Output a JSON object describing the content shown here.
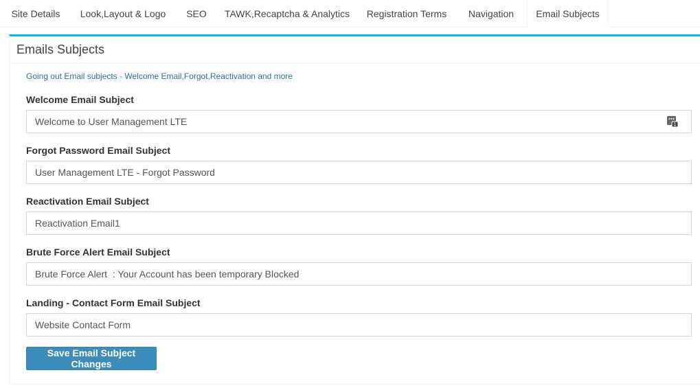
{
  "tabs": [
    {
      "label": "Site Details"
    },
    {
      "label": "Look,Layout & Logo"
    },
    {
      "label": "SEO"
    },
    {
      "label": "TAWK,Recaptcha & Analytics"
    },
    {
      "label": "Registration Terms"
    },
    {
      "label": "Navigation"
    },
    {
      "label": "Email Subjects",
      "active": true
    }
  ],
  "panel": {
    "title": "Emails Subjects",
    "description": "Going out Email subjects - Welcome Email,Forgot,Reactivation and more"
  },
  "fields": [
    {
      "label": "Welcome Email Subject",
      "value": "Welcome to User Management LTE"
    },
    {
      "label": "Forgot Password Email Subject",
      "value": "User Management LTE - Forgot Password"
    },
    {
      "label": "Reactivation Email Subject",
      "value": "Reactivation Email1"
    },
    {
      "label": "Brute Force Alert Email Subject",
      "value": "Brute Force Alert  : Your Account has been temporary Blocked"
    },
    {
      "label": "Landing - Contact Form Email Subject",
      "value": "Website Contact Form"
    }
  ],
  "save_button": {
    "label": "Save Email Subject Changes"
  },
  "colors": {
    "accent": "#00c0ef",
    "primary_button": "#3c8dbc",
    "description_text": "#31708f"
  },
  "icons": {
    "field_autofill": "password-manager-icon"
  }
}
